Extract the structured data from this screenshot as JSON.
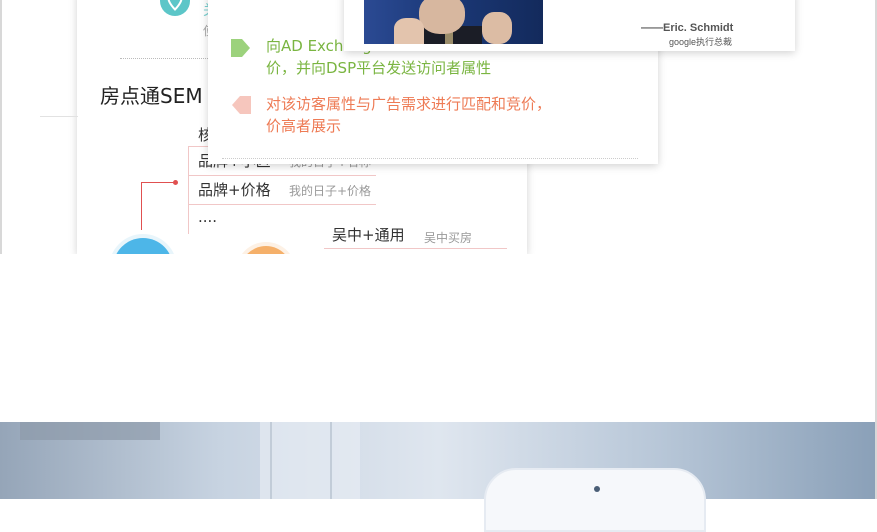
{
  "left_card": {
    "heading": "房点通SEM",
    "pin_text": "关",
    "pin_subtext": "使",
    "tree_top_label": "核",
    "rows": [
      {
        "main": "品牌+小区",
        "sub": "我的日子+名称"
      },
      {
        "main": "品牌+价格",
        "sub": "我的日子+价格"
      },
      {
        "main": "....",
        "sub": ""
      }
    ],
    "wz_row": {
      "main": "吴中+通用",
      "sub": "吴中买房"
    }
  },
  "mid_card": {
    "green_text_line1": "向AD Exchange",
    "green_text_line2": "价，并向DSP平台发送访问者属性",
    "red_text_line1": "对该访客属性与广告需求进行匹配和竞价，",
    "red_text_line2": "价高者展示"
  },
  "top_card": {
    "signature_name": "——Eric. Schmidt",
    "signature_title": "google执行总裁"
  },
  "colors": {
    "accent_green": "#7ab541",
    "accent_red": "#ee7b55",
    "accent_teal": "#5cc6c8"
  }
}
